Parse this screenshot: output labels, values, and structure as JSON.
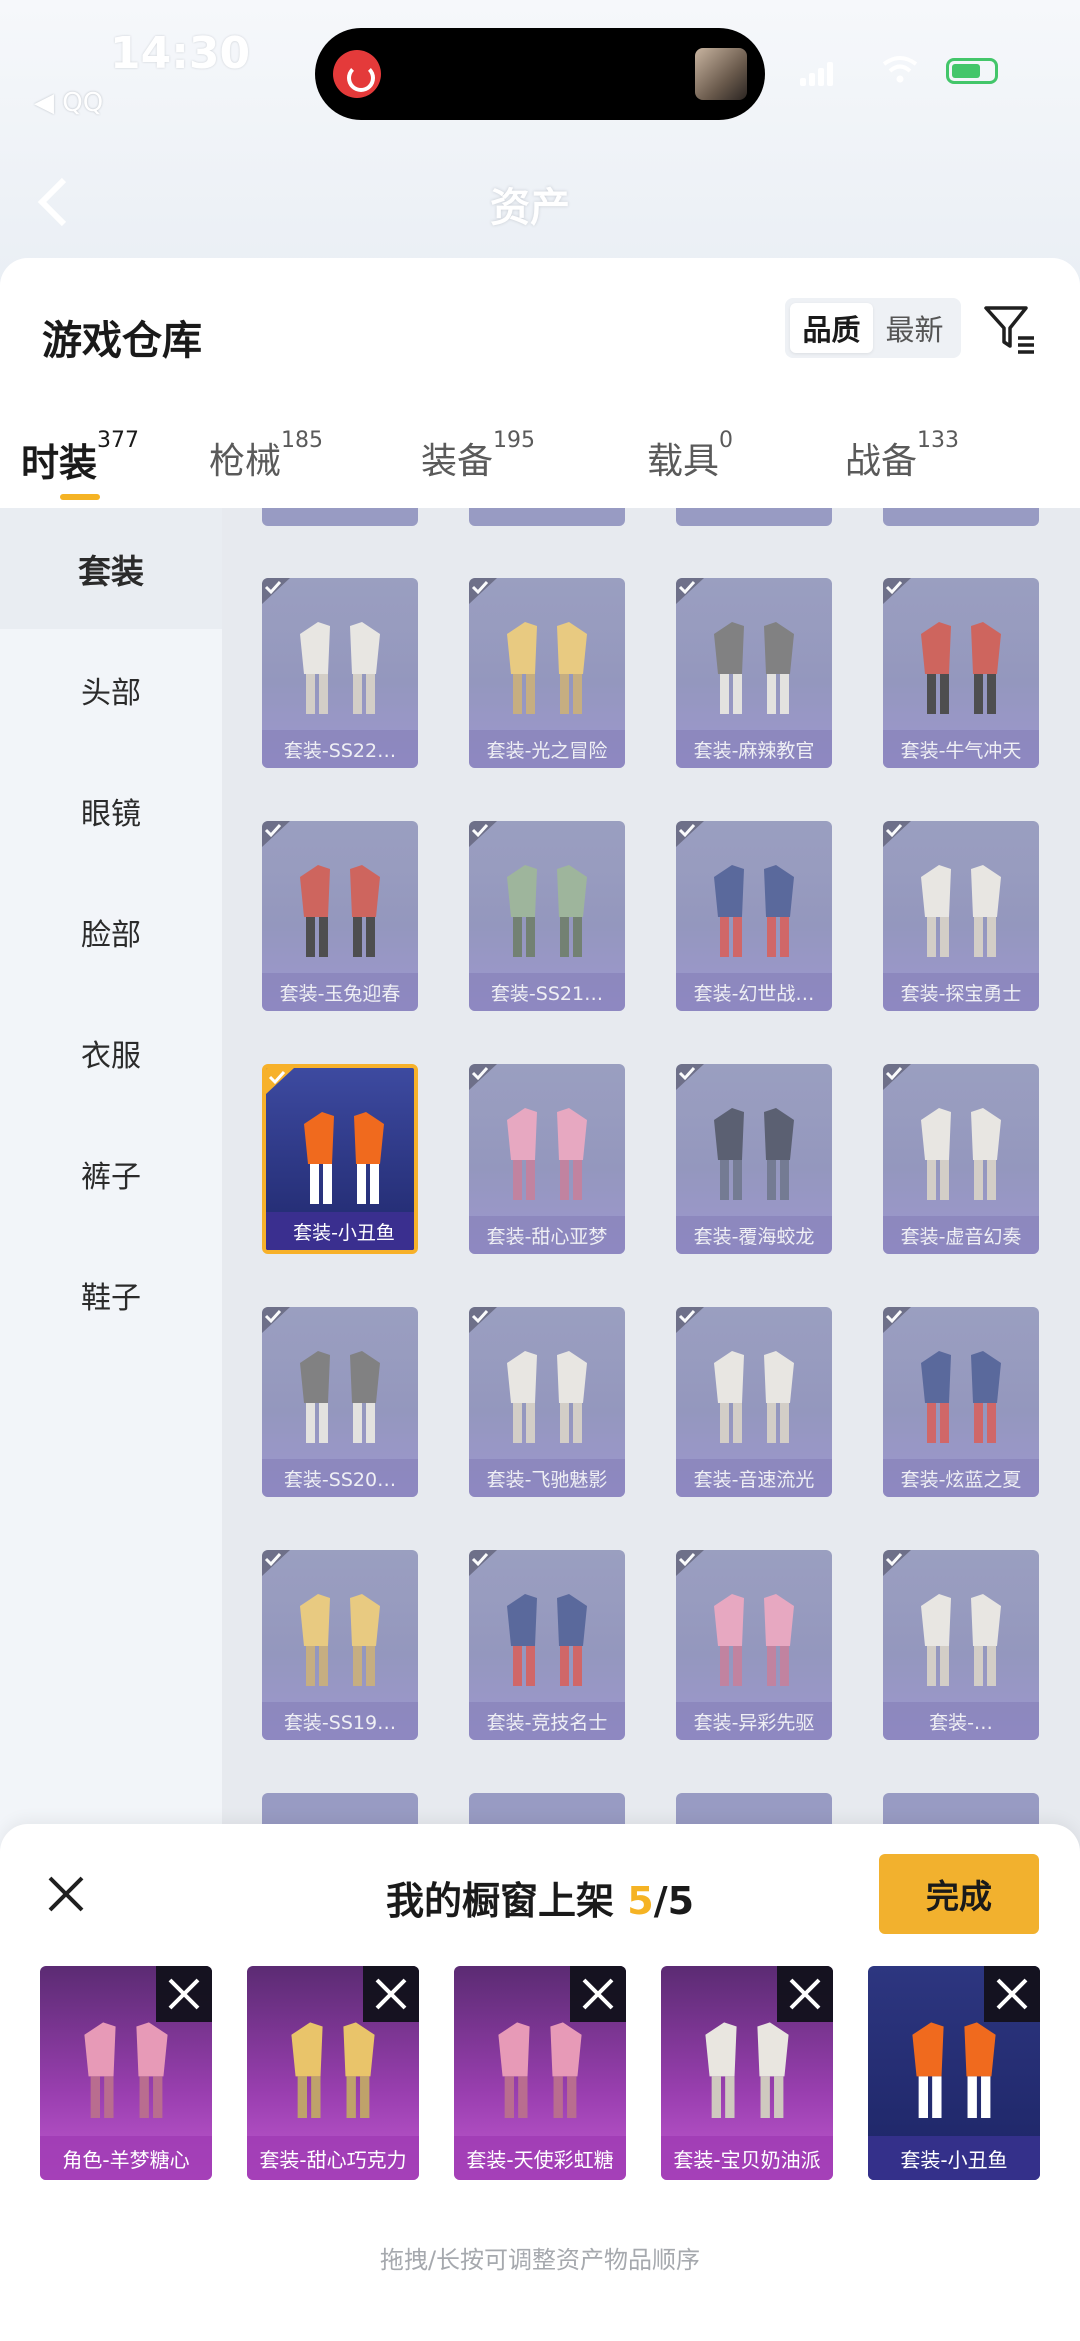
{
  "status": {
    "time": "14:30",
    "back_app": "◀ QQ"
  },
  "background": {
    "title": "资产"
  },
  "header": {
    "title": "游戏仓库",
    "sort_options": [
      "品质",
      "最新"
    ],
    "active_sort": "品质"
  },
  "tabs": [
    {
      "label": "时装",
      "count": "377",
      "active": true
    },
    {
      "label": "枪械",
      "count": "185"
    },
    {
      "label": "装备",
      "count": "195"
    },
    {
      "label": "载具",
      "count": "0"
    },
    {
      "label": "战备",
      "count": "133"
    }
  ],
  "subnav": [
    "套装",
    "头部",
    "眼镜",
    "脸部",
    "衣服",
    "裤子",
    "鞋子"
  ],
  "active_subnav": "套装",
  "items": [
    {
      "label": "套装-SS22…",
      "art": "white"
    },
    {
      "label": "套装-光之冒险",
      "art": "yellow"
    },
    {
      "label": "套装-麻辣教官",
      "art": "grey"
    },
    {
      "label": "套装-牛气冲天",
      "art": "red"
    },
    {
      "label": "套装-玉兔迎春",
      "art": "red"
    },
    {
      "label": "套装-SS21…",
      "art": "green"
    },
    {
      "label": "套装-幻世战…",
      "art": "blue"
    },
    {
      "label": "套装-探宝勇士",
      "art": "white"
    },
    {
      "label": "套装-小丑鱼",
      "art": "orange",
      "selected": true
    },
    {
      "label": "套装-甜心亚梦",
      "art": "pink"
    },
    {
      "label": "套装-覆海蛟龙",
      "art": "dark"
    },
    {
      "label": "套装-虚音幻奏",
      "art": "white"
    },
    {
      "label": "套装-SS20…",
      "art": "grey"
    },
    {
      "label": "套装-飞驰魅影",
      "art": "white"
    },
    {
      "label": "套装-音速流光",
      "art": "white"
    },
    {
      "label": "套装-炫蓝之夏",
      "art": "blue"
    },
    {
      "label": "套装-SS19…",
      "art": "yellow"
    },
    {
      "label": "套装-竞技名士",
      "art": "blue"
    },
    {
      "label": "套装-异彩先驱",
      "art": "pink"
    },
    {
      "label": "套装-…",
      "art": "white"
    }
  ],
  "showcase": {
    "title": "我的橱窗上架",
    "count": "5",
    "total": "/5",
    "done_label": "完成",
    "items": [
      {
        "label": "角色-羊梦糖心",
        "art": "pink"
      },
      {
        "label": "套装-甜心巧克力",
        "art": "yellow"
      },
      {
        "label": "套装-天使彩虹糖",
        "art": "pink"
      },
      {
        "label": "套装-宝贝奶油派",
        "art": "white"
      },
      {
        "label": "套装-小丑鱼",
        "art": "orange",
        "blue": true
      }
    ],
    "hint": "拖拽/长按可调整资产物品顺序"
  }
}
